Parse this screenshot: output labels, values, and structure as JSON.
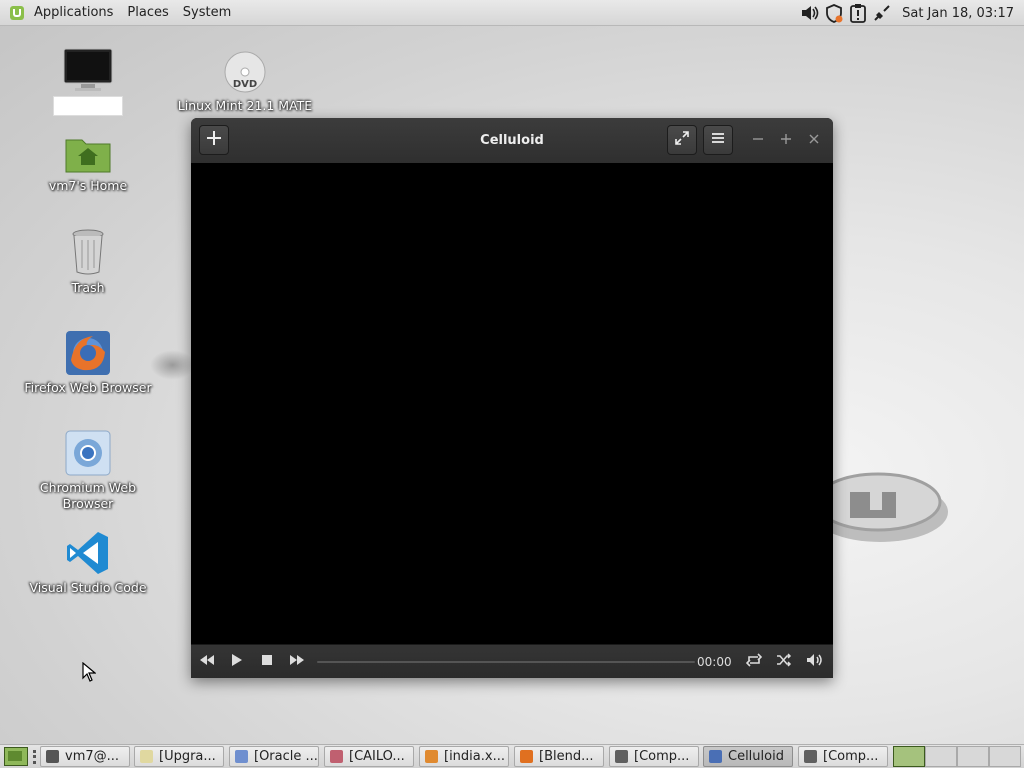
{
  "top_panel": {
    "menus": [
      "Applications",
      "Places",
      "System"
    ],
    "clock": "Sat Jan 18, 03:17"
  },
  "desktop_icons": [
    {
      "label": "",
      "icon": "monitor-icon"
    },
    {
      "label": "Linux Mint 21.1 MATE",
      "icon": "dvd-icon"
    },
    {
      "label": "vm7's Home",
      "icon": "home-folder-icon"
    },
    {
      "label": "Trash",
      "icon": "trash-icon"
    },
    {
      "label": "Firefox Web Browser",
      "icon": "firefox-icon"
    },
    {
      "label": "Chromium Web Browser",
      "icon": "chromium-icon"
    },
    {
      "label": "Visual Studio Code",
      "icon": "vscode-icon"
    }
  ],
  "window": {
    "title": "Celluloid",
    "time": "00:00",
    "progress": 0
  },
  "taskbar": {
    "items": [
      {
        "label": "vm7@...",
        "icon_color": "#555555"
      },
      {
        "label": "[Upgra...",
        "icon_color": "#e0d8a0"
      },
      {
        "label": "[Oracle ...",
        "icon_color": "#6f8fcf"
      },
      {
        "label": "[CAILO...",
        "icon_color": "#c06070"
      },
      {
        "label": "[india.x...",
        "icon_color": "#e08a30"
      },
      {
        "label": "[Blend...",
        "icon_color": "#e07020"
      },
      {
        "label": "[Comp...",
        "icon_color": "#606060"
      },
      {
        "label": "Celluloid",
        "icon_color": "#4a6fb5",
        "active": true
      },
      {
        "label": "[Comp...",
        "icon_color": "#606060"
      }
    ],
    "workspaces": 4,
    "active_workspace": 1
  },
  "colors": {
    "panel": "#dcdcdc",
    "window_header": "#353535",
    "video_bg": "#000000"
  }
}
